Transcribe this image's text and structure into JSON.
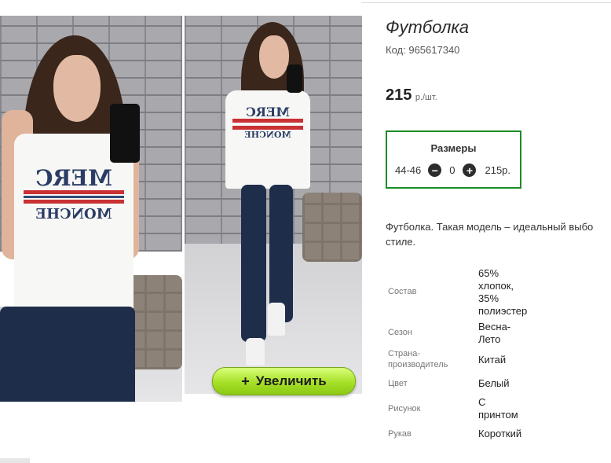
{
  "gallery": {
    "zoom_button_label": "Увеличить",
    "zoom_button_icon": "+",
    "print_text_1": "MERC",
    "print_text_2": "MONCHE"
  },
  "product": {
    "title": "Футболка",
    "code_label": "Код:",
    "code": "965617340",
    "price": "215",
    "price_unit": "р./шт.",
    "sizes": {
      "title": "Размеры",
      "size": "44-46",
      "quantity": "0",
      "size_price": "215р."
    },
    "description_line1": "Футболка. Такая модель – идеальный выбо",
    "description_line2": "стиле.",
    "specs": [
      {
        "label": "Состав",
        "value": "65% хлопок, 35% полиэстер"
      },
      {
        "label": "Сезон",
        "value": "Весна-Лето"
      },
      {
        "label": "Страна-производитель",
        "value": "Китай"
      },
      {
        "label": "Цвет",
        "value": "Белый"
      },
      {
        "label": "Рисунок",
        "value": "С принтом"
      },
      {
        "label": "Рукав",
        "value": "Короткий"
      }
    ]
  },
  "colors": {
    "accent_green": "#188d24",
    "button_green": "#a6e027"
  }
}
